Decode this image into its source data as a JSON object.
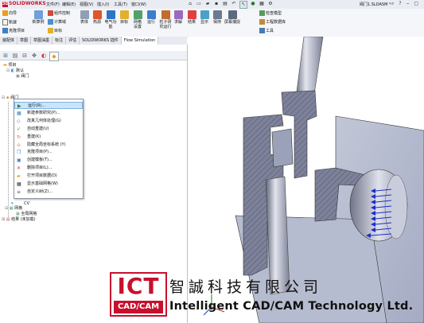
{
  "app": {
    "brand": "SOLIDWORKS",
    "brand_prefix": "3DS",
    "document_title": "阀门1.SLDASM *"
  },
  "menubar": [
    "文件(F)",
    "编辑(E)",
    "视图(V)",
    "插入(I)",
    "工具(T)",
    "窗口(W)"
  ],
  "ribbon": {
    "left_stack": [
      "向导",
      "新建",
      "克隆项目"
    ],
    "study_big": "新算例",
    "study_small": [
      "组件控制",
      "计算域",
      "目标"
    ],
    "small_col3": [
      "应用",
      "网格"
    ],
    "group2": [
      "表体",
      "热源",
      "电气功能",
      "目标"
    ],
    "group3": [
      "网格设置",
      "运行",
      "粒子研究运行",
      "求解",
      "结果",
      "显示",
      "保持",
      "屏幕捕捉"
    ],
    "right_stack": [
      "检查模型",
      "工程数据库",
      "工具"
    ]
  },
  "tabs": [
    "装配体",
    "草图",
    "草图油墨",
    "标注",
    "评估",
    "SOLIDWORKS 插件",
    "Flow Simulation"
  ],
  "active_tab": "Flow Simulation",
  "tree": {
    "root": "项目",
    "default_item": "默认",
    "part_item": "阀门",
    "assembly_item": "阀门",
    "mesh_group": "网格",
    "global_mesh": "全局网格",
    "results": "结果 (未加载)",
    "cv": "CV"
  },
  "context_menu": [
    {
      "label": "运行(R)...",
      "icon": "run-icon",
      "highlight": true
    },
    {
      "label": "新建参数研究(P)...",
      "icon": "param-icon"
    },
    {
      "label": "改真几何体处理(G)",
      "icon": "geometry-icon"
    },
    {
      "label": "自动重建(U)",
      "icon": "check-icon"
    },
    {
      "label": "重建(K)",
      "icon": "rebuild-icon"
    },
    {
      "label": "隐藏全局坐标系统 (Y)",
      "icon": "axis-icon"
    },
    {
      "label": "克隆项目(P)...",
      "icon": "clone-icon"
    },
    {
      "label": "创建模板(T)...",
      "icon": "template-icon"
    },
    {
      "label": "删除项目(L)...",
      "icon": "delete-icon"
    },
    {
      "label": "打开项目数据(D)",
      "icon": "folder-icon"
    },
    {
      "label": "显示基础网格(W)",
      "icon": "grid-icon"
    },
    {
      "label": "自定义树(Z)...",
      "icon": "tree-icon"
    }
  ],
  "watermark": {
    "logo_top": "ICT",
    "logo_bottom": "CAD/CAM",
    "company_zh": "智誠科技有限公司",
    "company_en": "Intelligent CAD/CAM Technology Ltd."
  },
  "colors": {
    "accent_red": "#c8102e",
    "highlight": "#cce4f7",
    "steel": "#a8b0c8"
  }
}
